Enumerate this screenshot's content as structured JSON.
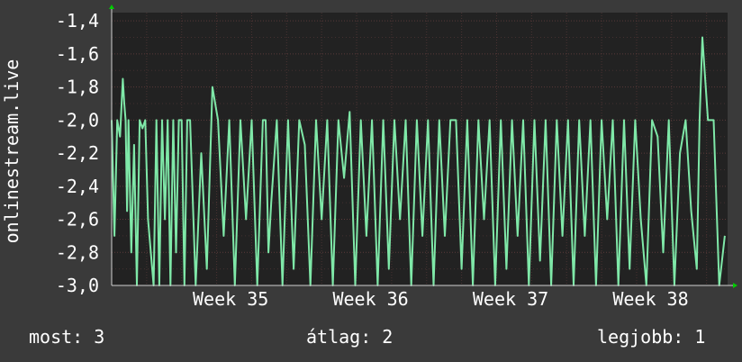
{
  "chart_data": {
    "type": "line",
    "ylabel": "onlinestream.live",
    "ylim": [
      -3.0,
      -1.35
    ],
    "yticks": [
      "-1,4",
      "-1,6",
      "-1,8",
      "-2,0",
      "-2,2",
      "-2,4",
      "-2,6",
      "-2,8",
      "-3,0"
    ],
    "ytick_values": [
      -1.4,
      -1.6,
      -1.8,
      -2.0,
      -2.2,
      -2.4,
      -2.6,
      -2.8,
      -3.0
    ],
    "xticks": [
      "Week 35",
      "Week 36",
      "Week 37",
      "Week 38"
    ],
    "xlim": [
      0,
      4.4
    ],
    "xtick_values": [
      0.85,
      1.85,
      2.85,
      3.85
    ],
    "grid": true,
    "colors": {
      "background": "#3a3a3a",
      "plot_background": "#222222",
      "grid": "#5a3a3a",
      "line": "#7fe8a8",
      "axis": "#d0d0d0",
      "arrow": "#00cc00"
    },
    "series": [
      {
        "x": [
          0.0,
          0.02,
          0.04,
          0.06,
          0.08,
          0.09,
          0.1,
          0.11,
          0.12,
          0.14,
          0.16,
          0.18,
          0.2,
          0.22,
          0.24,
          0.26,
          0.28,
          0.3,
          0.32,
          0.34,
          0.36,
          0.38,
          0.4,
          0.42,
          0.44,
          0.46,
          0.48,
          0.5,
          0.52,
          0.54,
          0.56,
          0.6,
          0.64,
          0.68,
          0.72,
          0.76,
          0.8,
          0.84,
          0.88,
          0.92,
          0.96,
          1.0,
          1.04,
          1.08,
          1.1,
          1.12,
          1.14,
          1.18,
          1.22,
          1.26,
          1.3,
          1.34,
          1.38,
          1.42,
          1.46,
          1.5,
          1.54,
          1.58,
          1.62,
          1.66,
          1.7,
          1.74,
          1.78,
          1.82,
          1.86,
          1.9,
          1.94,
          1.98,
          2.02,
          2.06,
          2.1,
          2.14,
          2.18,
          2.22,
          2.26,
          2.3,
          2.34,
          2.38,
          2.42,
          2.46,
          2.5,
          2.54,
          2.58,
          2.62,
          2.66,
          2.7,
          2.74,
          2.78,
          2.82,
          2.86,
          2.9,
          2.94,
          2.98,
          3.02,
          3.06,
          3.1,
          3.14,
          3.18,
          3.22,
          3.26,
          3.3,
          3.34,
          3.38,
          3.42,
          3.46,
          3.5,
          3.54,
          3.58,
          3.62,
          3.66,
          3.7,
          3.74,
          3.78,
          3.82,
          3.86,
          3.9,
          3.94,
          3.98,
          4.02,
          4.06,
          4.1,
          4.14,
          4.18,
          4.2,
          4.22,
          4.26,
          4.3,
          4.34,
          4.38
        ],
        "values": [
          -2.0,
          -2.7,
          -2.0,
          -2.1,
          -1.75,
          -1.9,
          -2.0,
          -2.55,
          -2.0,
          -2.8,
          -2.15,
          -3.0,
          -2.0,
          -2.05,
          -2.0,
          -2.6,
          -2.8,
          -3.0,
          -2.0,
          -3.0,
          -2.0,
          -2.6,
          -2.0,
          -3.0,
          -2.0,
          -2.8,
          -2.0,
          -2.0,
          -3.0,
          -2.0,
          -2.0,
          -3.0,
          -2.2,
          -2.9,
          -1.8,
          -2.0,
          -2.7,
          -2.0,
          -3.0,
          -2.0,
          -2.6,
          -2.0,
          -3.0,
          -2.0,
          -2.0,
          -2.8,
          -2.5,
          -2.0,
          -3.0,
          -2.0,
          -2.9,
          -2.0,
          -2.15,
          -3.0,
          -2.0,
          -2.6,
          -2.0,
          -3.0,
          -2.0,
          -2.35,
          -1.95,
          -3.0,
          -2.0,
          -2.7,
          -2.0,
          -3.0,
          -2.0,
          -2.9,
          -2.0,
          -2.6,
          -2.0,
          -3.0,
          -2.0,
          -2.7,
          -2.0,
          -3.0,
          -2.0,
          -2.7,
          -2.0,
          -2.0,
          -2.9,
          -2.0,
          -3.0,
          -2.0,
          -2.6,
          -2.0,
          -3.0,
          -2.0,
          -2.9,
          -2.0,
          -2.7,
          -2.0,
          -3.0,
          -2.0,
          -2.85,
          -2.0,
          -3.0,
          -2.0,
          -2.7,
          -2.0,
          -3.0,
          -2.0,
          -2.7,
          -2.0,
          -3.0,
          -2.0,
          -2.6,
          -2.0,
          -3.0,
          -2.0,
          -2.9,
          -2.0,
          -2.6,
          -3.0,
          -2.0,
          -2.1,
          -2.8,
          -2.0,
          -3.0,
          -2.2,
          -2.0,
          -2.55,
          -2.9,
          -2.0,
          -1.5,
          -2.0,
          -2.0,
          -3.0,
          -2.7
        ]
      }
    ]
  },
  "footer": {
    "current": "most: 3",
    "average": "átlag: 2",
    "best": "legjobb: 1"
  }
}
